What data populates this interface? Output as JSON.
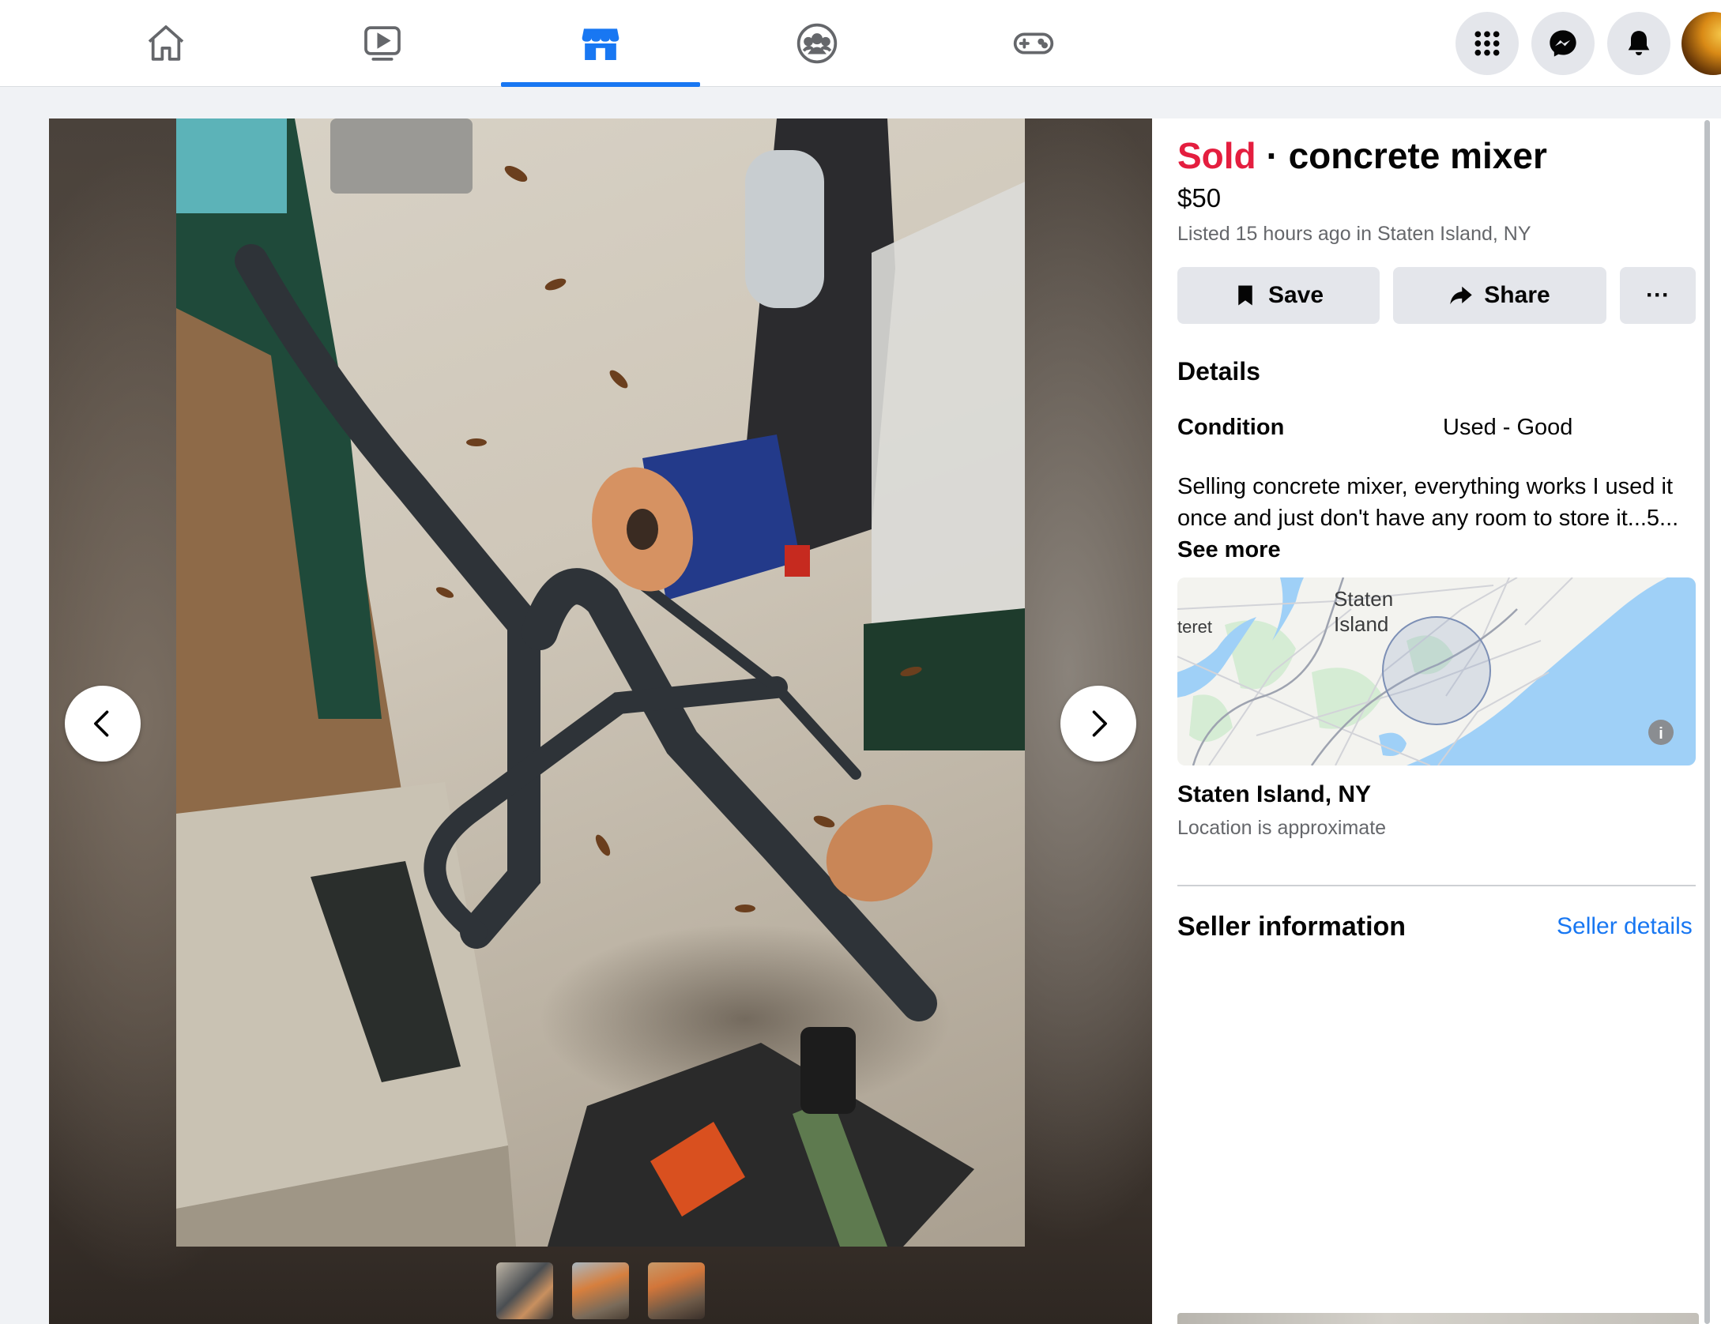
{
  "topnav": {
    "tabs": [
      {
        "icon": "home-icon",
        "active": false
      },
      {
        "icon": "watch-icon",
        "active": false
      },
      {
        "icon": "marketplace-icon",
        "active": true
      },
      {
        "icon": "groups-icon",
        "active": false
      },
      {
        "icon": "gaming-icon",
        "active": false
      }
    ],
    "right": [
      "menu-grid-icon",
      "messenger-icon",
      "notifications-icon",
      "avatar"
    ],
    "accent": "#1877f2"
  },
  "listing": {
    "status": "Sold",
    "separator": "·",
    "title": "concrete mixer",
    "price": "$50",
    "listed": "Listed 15 hours ago in Staten Island, NY",
    "actions": {
      "save_label": "Save",
      "share_label": "Share",
      "more_label": "···"
    },
    "details": {
      "heading": "Details",
      "condition_label": "Condition",
      "condition_value": "Used - Good",
      "description": "Selling concrete mixer, everything works I used it once and just don't have any room to store it...5... ",
      "see_more": "See more"
    },
    "map": {
      "label_1": "Staten",
      "label_2": "Island",
      "label_left": "teret",
      "info_icon": "i"
    },
    "location": {
      "name": "Staten Island, NY",
      "note": "Location is approximate"
    },
    "seller": {
      "heading": "Seller information",
      "link": "Seller details"
    },
    "status_color": "#e41e3f"
  },
  "viewer": {
    "prev_icon": "chevron-left-icon",
    "next_icon": "chevron-right-icon",
    "thumbnail_count": 3
  }
}
